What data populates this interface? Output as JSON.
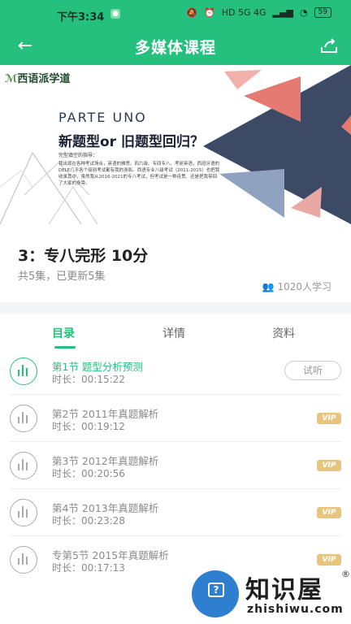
{
  "status_bar": {
    "time": "下午3:34",
    "net": "HD 5G 4G",
    "battery": "59"
  },
  "appbar": {
    "title": "多媒体课程"
  },
  "banner": {
    "logo": "西语派学道",
    "parte": "PARTE UNO",
    "question": "新题型or 旧题型回归？",
    "line1": "完型填空的指导：",
    "line2": "我出现在各种考试场合，英语的雅思、四六级、专四专八、考研英语，西班牙语的DELE几乎各个级别考试都有我的身影。西语专业八级考试（2011-2015）也把我收录其中，虽然我从2016-2021的专八考试，但考试是一种连贯、还是把我带回了大家的身旁。"
  },
  "course": {
    "name": "3：专八完形 10分",
    "episodes": "共5集，已更新5集",
    "learners": "1020人学习"
  },
  "tabs": [
    "目录",
    "详情",
    "资料"
  ],
  "lessons": [
    {
      "title": "第1节 题型分析预测",
      "duration": "时长：00:15:22",
      "action": "试听"
    },
    {
      "title": "第2节 2011年真题解析",
      "duration": "时长：00:19:12",
      "badge": "VIP"
    },
    {
      "title": "第3节 2012年真题解析",
      "duration": "时长：00:20:56",
      "badge": "VIP"
    },
    {
      "title": "第4节 2013年真题解析",
      "duration": "时长：00:23:28",
      "badge": "VIP"
    },
    {
      "title": "专第5节 2015年真题解析",
      "duration": "时长：00:17:13",
      "badge": "VIP"
    }
  ],
  "watermark": {
    "zh": "知识屋",
    "en": "zhishiwu.com",
    "reg": "®"
  },
  "colors": {
    "accent": "#25c07d",
    "vip": "#e8c57f",
    "navy": "#3c4a66",
    "coral": "#e57a72"
  }
}
